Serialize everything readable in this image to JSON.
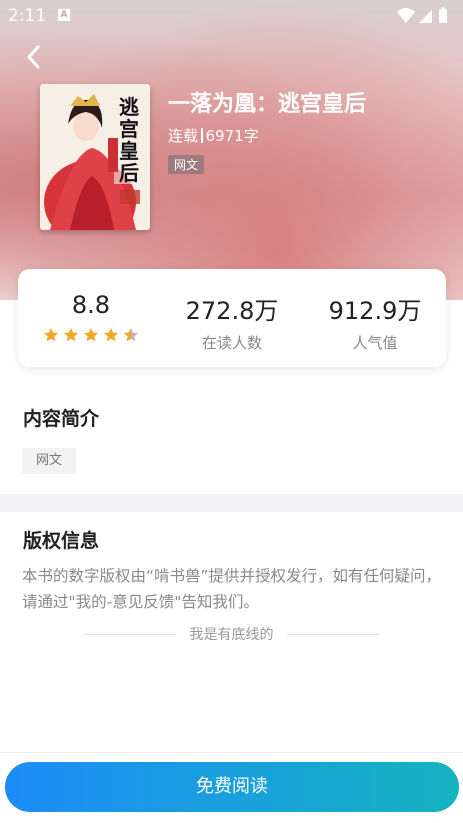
{
  "status_bar": {
    "time": "2:11",
    "notification_letter": "A"
  },
  "book": {
    "title": "一落为凰：逃宫皇后",
    "status": "连载",
    "word_count": "6971字",
    "genre": "网文"
  },
  "stats": {
    "rating": "8.8",
    "rating_stars": 4.4,
    "readers_value": "272.8万",
    "readers_label": "在读人数",
    "popularity_value": "912.9万",
    "popularity_label": "人气值"
  },
  "intro": {
    "title": "内容简介",
    "tag": "网文"
  },
  "copyright": {
    "title": "版权信息",
    "text": "本书的数字版权由“啃书兽”提供并授权发行，如有任何疑问，请通过\"我的-意见反馈\"告知我们。",
    "end_text": "我是有底线的"
  },
  "action": {
    "read_button": "免费阅读"
  },
  "colors": {
    "accent_start": "#1d8cf8",
    "accent_end": "#15b3c0",
    "star": "#f5a623"
  }
}
